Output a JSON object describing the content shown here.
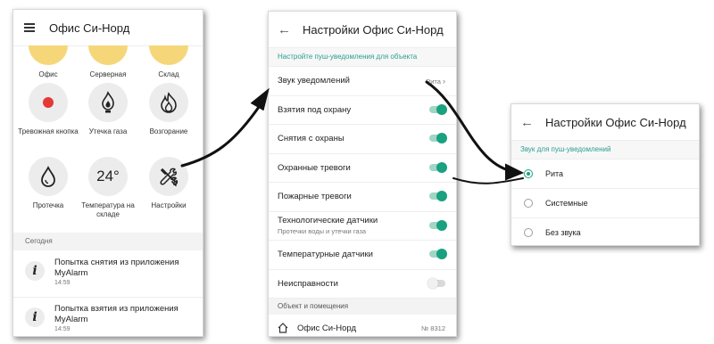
{
  "left": {
    "title": "Офис Си-Норд",
    "top_tiles": [
      "Офис",
      "Серверная",
      "Склад"
    ],
    "tiles": [
      {
        "label": "Тревожная кнопка",
        "icon": "red-dot-icon"
      },
      {
        "label": "Утечка газа",
        "icon": "gas-flame-icon"
      },
      {
        "label": "Возгорание",
        "icon": "fire-icon"
      },
      {
        "label": "Протечка",
        "icon": "water-drop-icon"
      },
      {
        "label": "Температура на складе",
        "value": "24°"
      },
      {
        "label": "Настройки",
        "icon": "wrench-icon"
      }
    ],
    "section": "Сегодня",
    "events": [
      {
        "text": "Попытка снятия из приложения MyAlarm",
        "time": "14:59"
      },
      {
        "text": "Попытка взятия из приложения MyAlarm",
        "time": "14:59"
      }
    ]
  },
  "middle": {
    "title": "Настройки Офис Си-Норд",
    "hint": "Настройте пуш-уведомления для объекта",
    "sound": {
      "label": "Звук уведомлений",
      "value": "Рита"
    },
    "toggles": [
      {
        "label": "Взятия под охрану",
        "on": true
      },
      {
        "label": "Снятия с охраны",
        "on": true
      },
      {
        "label": "Охранные тревоги",
        "on": true
      },
      {
        "label": "Пожарные тревоги",
        "on": true
      },
      {
        "label": "Технологические датчики",
        "sub": "Протечки воды и утечки газа",
        "on": true
      },
      {
        "label": "Температурные датчики",
        "on": true
      },
      {
        "label": "Неисправности",
        "on": false
      }
    ],
    "objects_head": "Объект и помещения",
    "object": {
      "name": "Офис Си-Норд",
      "number": "№ 8312"
    }
  },
  "right": {
    "title": "Настройки Офис Си-Норд",
    "hint": "Звук для пуш-уведомлений",
    "options": [
      {
        "label": "Рита",
        "selected": true
      },
      {
        "label": "Системные",
        "selected": false
      },
      {
        "label": "Без звука",
        "selected": false
      }
    ]
  }
}
